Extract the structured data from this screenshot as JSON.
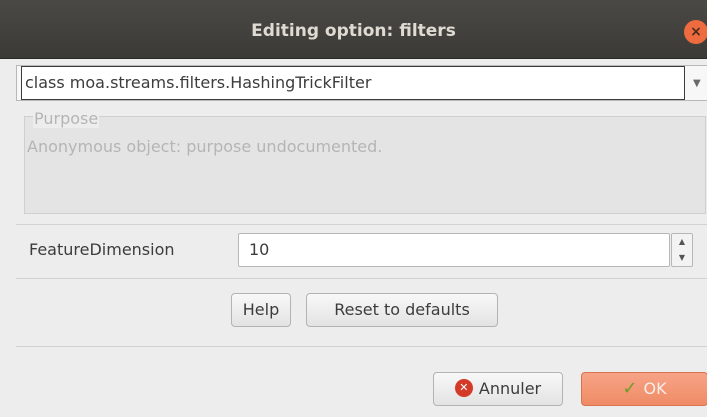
{
  "window": {
    "title": "Editing option: filters",
    "close_glyph": "×"
  },
  "class_select": {
    "value": "class moa.streams.filters.HashingTrickFilter",
    "arrow_glyph": "▼"
  },
  "purpose": {
    "legend": "Purpose",
    "text": "Anonymous object: purpose undocumented."
  },
  "feature": {
    "label": "FeatureDimension",
    "value": "10"
  },
  "buttons": {
    "help": "Help",
    "reset": "Reset to defaults",
    "cancel": "Annuler",
    "ok": "OK"
  },
  "icons": {
    "close": "close-icon",
    "cancel": "cancel-icon",
    "ok": "check-icon",
    "dropdown": "chevron-down-icon"
  },
  "colors": {
    "titlebar": "#3d3c39",
    "close": "#ee6a3f",
    "ok_button": "#f09370",
    "cancel_icon": "#d33a28",
    "check_icon": "#6c9e2a"
  }
}
